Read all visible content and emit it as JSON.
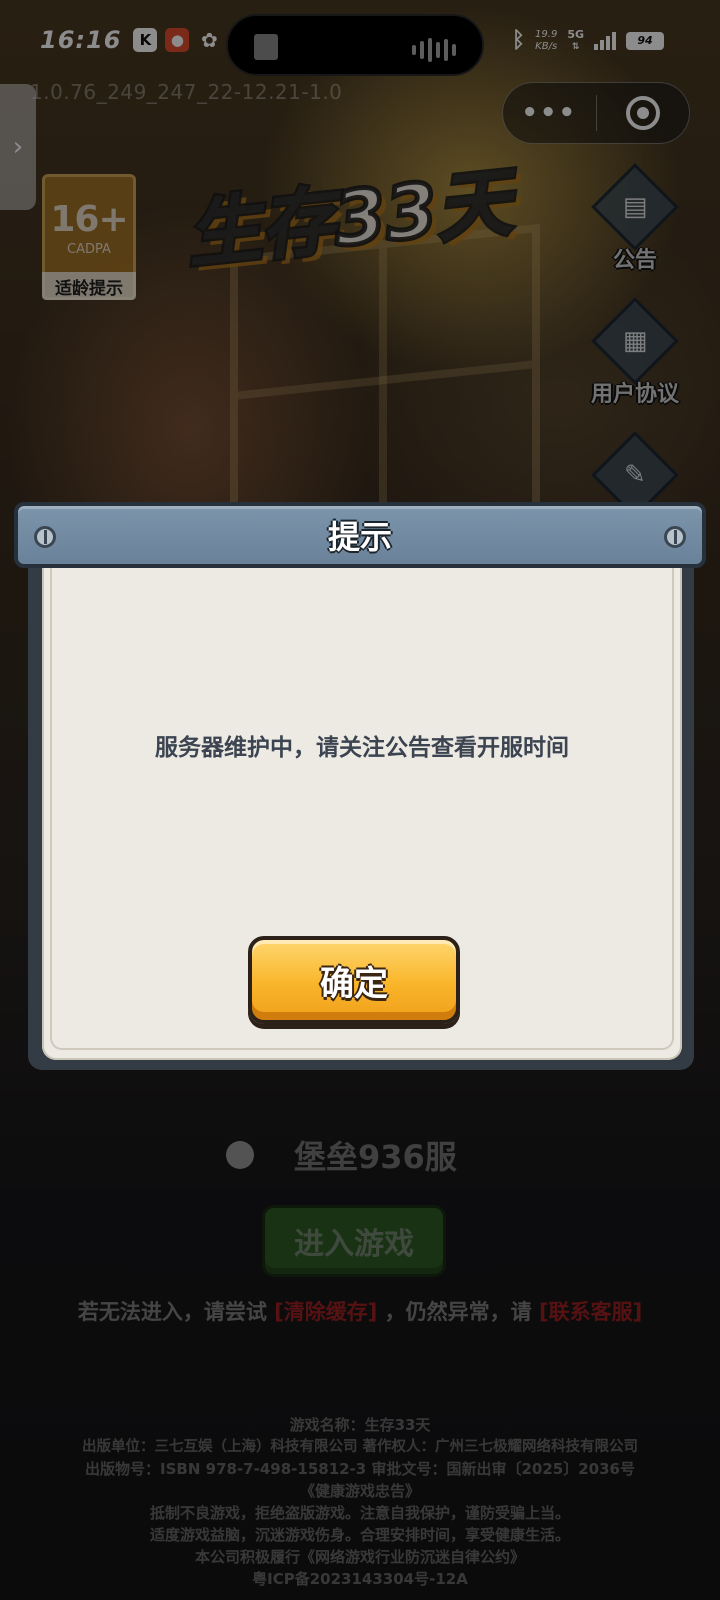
{
  "status_bar": {
    "time": "16:16",
    "net_speed_value": "19.9",
    "net_speed_unit": "KB/s",
    "network": "5G",
    "battery": "94"
  },
  "version_text": "1.0.76_249_247_22-12.21-1.0",
  "capsule": {
    "more_icon": "ellipsis-icon",
    "close_icon": "target-icon"
  },
  "age_rating": {
    "value": "16+",
    "org": "CADPA",
    "label": "适龄提示"
  },
  "logo_text": "生存33天",
  "side_menu": [
    {
      "label": "公告",
      "icon": "notice-icon"
    },
    {
      "label": "用户协议",
      "icon": "agreement-icon"
    },
    {
      "label": "",
      "icon": "report-icon"
    }
  ],
  "dialog": {
    "title": "提示",
    "message": "服务器维护中，请关注公告查看开服时间",
    "confirm_label": "确定"
  },
  "server": {
    "name": "堡垒936服"
  },
  "enter_game_label": "进入游戏",
  "help": {
    "prefix": "若无法进入，请尝试",
    "clear_cache": "[清除缓存]",
    "middle": "，仍然异常，请",
    "contact": "[联系客服]"
  },
  "footer_lines": [
    "游戏名称：生存33天",
    "出版单位：三七互娱（上海）科技有限公司 著作权人：广州三七极耀网络科技有限公司",
    "出版物号：ISBN 978-7-498-15812-3 审批文号：国新出审〔2025〕2036号",
    "《健康游戏忠告》",
    "抵制不良游戏，拒绝盗版游戏。注意自我保护，谨防受骗上当。",
    "适度游戏益脑，沉迷游戏伤身。合理安排时间，享受健康生活。",
    "本公司积极履行《网络游戏行业防沉迷自律公约》",
    "粤ICP备2023143304号-12A"
  ]
}
